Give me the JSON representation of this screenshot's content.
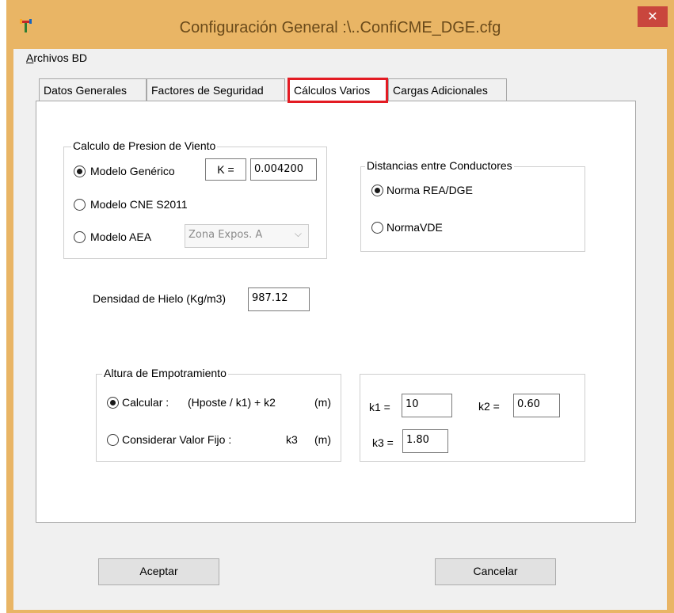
{
  "window": {
    "title": "Configuración General :\\..ConfiCME_DGE.cfg",
    "close_symbol": "✕"
  },
  "menu": {
    "archivos": "Archivos BD"
  },
  "tabs": [
    {
      "label": "Datos Generales"
    },
    {
      "label": "Factores de Seguridad"
    },
    {
      "label": "Cálculos Varios",
      "selected": true
    },
    {
      "label": "Cargas Adicionales"
    }
  ],
  "viento": {
    "title": "Calculo de Presion de Viento",
    "opt_generico": "Modelo Genérico",
    "k_label": "K =",
    "k_value": "0.004200",
    "opt_cne": "Modelo CNE S2011",
    "opt_aea": "Modelo AEA",
    "zona_value": "Zona Expos. A",
    "selected": "generico"
  },
  "distancias": {
    "title": "Distancias entre Conductores",
    "opt_rea": "Norma REA/DGE",
    "opt_vde": "NormaVDE",
    "selected": "rea"
  },
  "hielo": {
    "label": "Densidad de Hielo (Kg/m3)",
    "value": "987.12"
  },
  "empotramiento": {
    "title": "Altura de Empotramiento",
    "opt_calcular": "Calcular :",
    "formula": "(Hposte / k1) + k2",
    "unit_1": "(m)",
    "opt_fijo": "Considerar Valor  Fijo :",
    "k3_text": "k3",
    "unit_2": "(m)",
    "selected": "calcular"
  },
  "coeficientes": {
    "k1_label": "k1 =",
    "k1_value": "10",
    "k2_label": "k2 =",
    "k2_value": "0.60",
    "k3_label": "k3 =",
    "k3_value": "1.80"
  },
  "buttons": {
    "aceptar": "Aceptar",
    "cancelar": "Cancelar"
  },
  "colors": {
    "frame": "#e9b565",
    "close": "#c9463d",
    "tab_highlight": "#e31b23"
  },
  "icons": {
    "app": "app-logo-icon",
    "close": "close-icon",
    "dropdown": "chevron-down-icon"
  }
}
